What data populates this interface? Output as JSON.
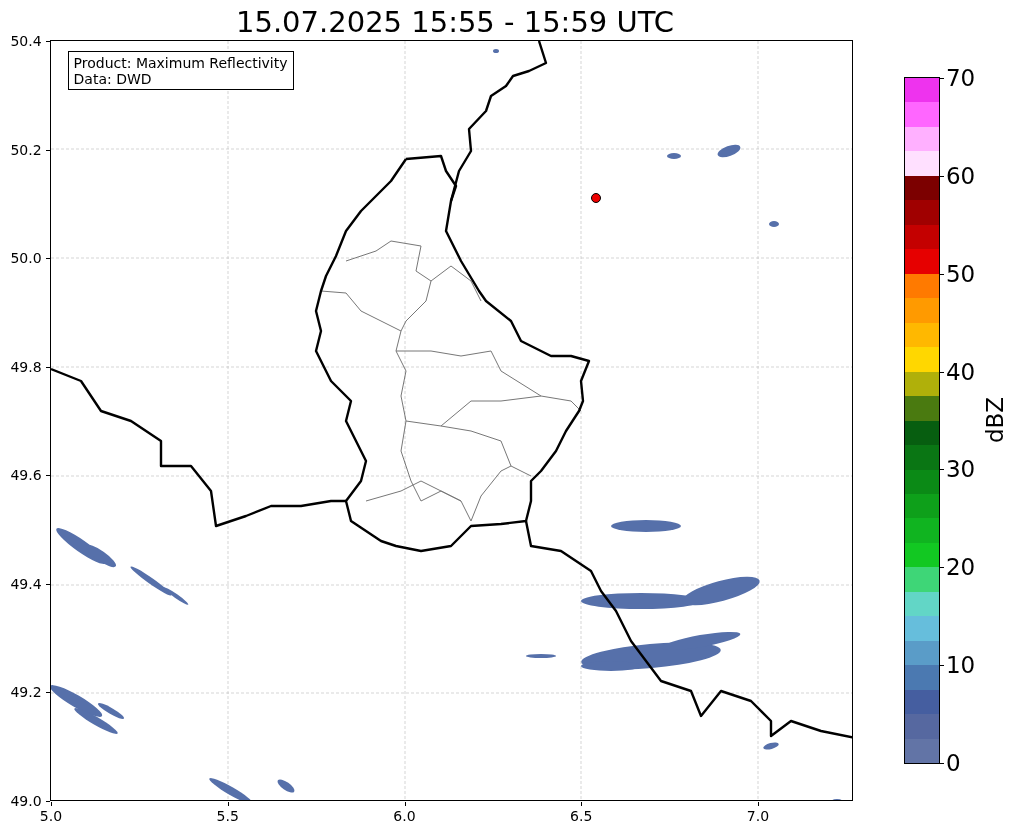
{
  "title": "15.07.2025 15:55 - 15:59 UTC",
  "info_box": {
    "lines": [
      "Product: Maximum Reflectivity",
      "Data: DWD"
    ]
  },
  "y_ticks": [
    "50.4",
    "50.2",
    "50.0",
    "49.8",
    "49.6",
    "49.4",
    "49.2",
    "49.0"
  ],
  "x_ticks": [
    "5.0",
    "5.5",
    "6.0",
    "6.5",
    "7.0"
  ],
  "colorbar": {
    "label": "dBZ",
    "ticks": [
      "70",
      "60",
      "50",
      "40",
      "30",
      "20",
      "10",
      "0"
    ],
    "segments": [
      {
        "color": "#ee33ee"
      },
      {
        "color": "#ff66ff"
      },
      {
        "color": "#ffb0ff"
      },
      {
        "color": "#ffe0ff"
      },
      {
        "color": "#7c0000"
      },
      {
        "color": "#a00000"
      },
      {
        "color": "#c40000"
      },
      {
        "color": "#e60000"
      },
      {
        "color": "#ff7a00"
      },
      {
        "color": "#ff9a00"
      },
      {
        "color": "#ffb800"
      },
      {
        "color": "#ffd700"
      },
      {
        "color": "#b0b00a"
      },
      {
        "color": "#4a7a10"
      },
      {
        "color": "#075e10"
      },
      {
        "color": "#0a7614"
      },
      {
        "color": "#0b8a16"
      },
      {
        "color": "#0ea01a"
      },
      {
        "color": "#10b420"
      },
      {
        "color": "#12c822"
      },
      {
        "color": "#3ed677"
      },
      {
        "color": "#62d6c6"
      },
      {
        "color": "#66bedc"
      },
      {
        "color": "#5a9cc8"
      },
      {
        "color": "#4b79b1"
      },
      {
        "color": "#455ea0"
      },
      {
        "color": "#5668a0"
      },
      {
        "color": "#6274a6"
      }
    ]
  }
}
